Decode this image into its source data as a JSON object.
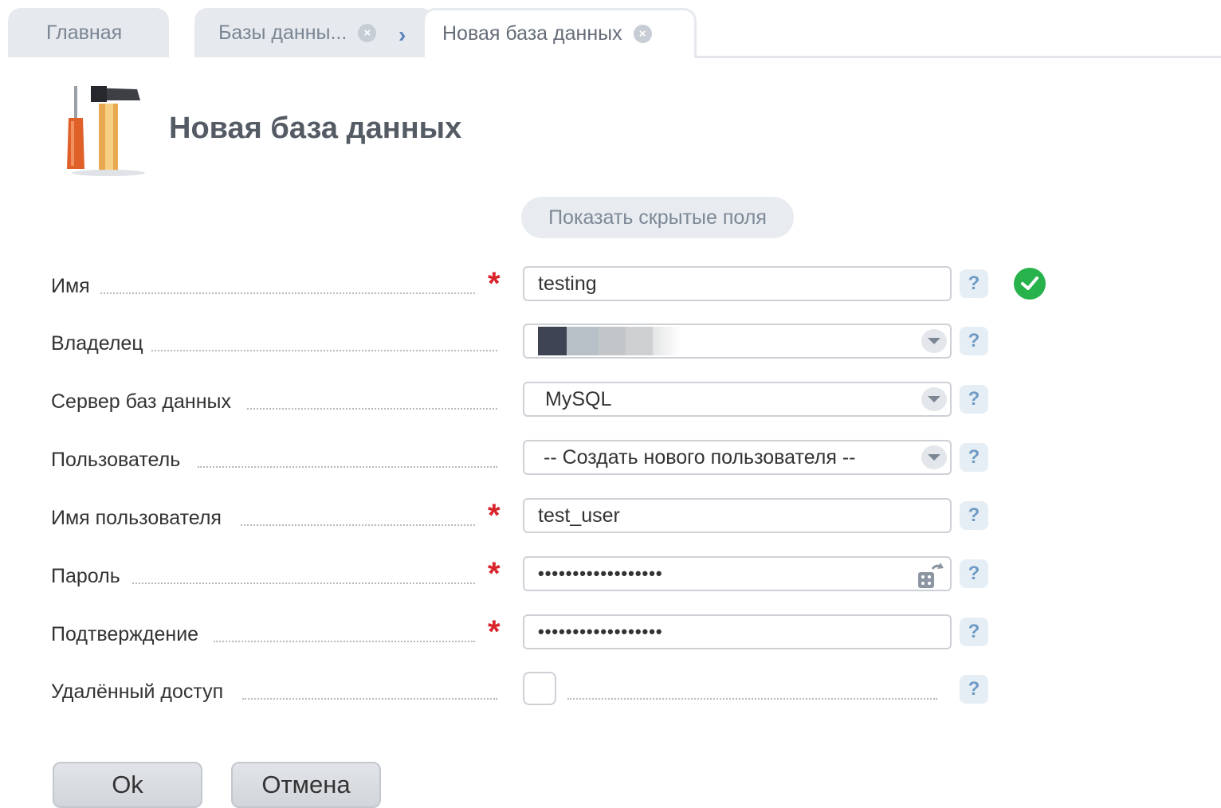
{
  "tabs": {
    "home": "Главная",
    "databases": "Базы данны...",
    "new_db": "Новая база данных"
  },
  "header": {
    "title": "Новая база данных"
  },
  "show_hidden_label": "Показать скрытые поля",
  "form": {
    "name": {
      "label": "Имя",
      "value": "testing"
    },
    "owner": {
      "label": "Владелец"
    },
    "server": {
      "label": "Сервер баз данных",
      "value": "MySQL"
    },
    "user": {
      "label": "Пользователь",
      "value": "-- Создать нового пользователя --"
    },
    "username": {
      "label": "Имя пользователя",
      "value": "test_user"
    },
    "password": {
      "label": "Пароль",
      "value": "••••••••••••••••••"
    },
    "confirm": {
      "label": "Подтверждение",
      "value": "••••••••••••••••••"
    },
    "remote": {
      "label": "Удалённый доступ",
      "checked": false
    },
    "required_mark": "*",
    "help_mark": "?"
  },
  "buttons": {
    "ok": "Ok",
    "cancel": "Отмена"
  },
  "colors": {
    "accent": "#5a84b8",
    "required": "#d9232a",
    "success": "#28b24b"
  }
}
